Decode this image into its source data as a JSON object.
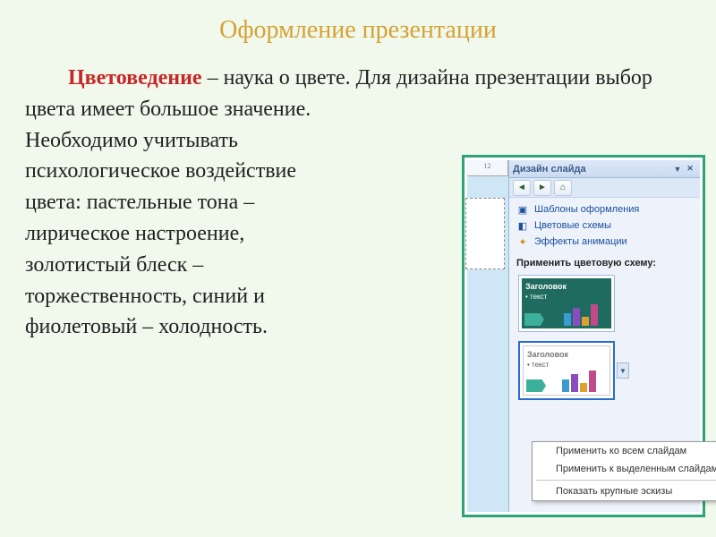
{
  "slide": {
    "title": "Оформление презентации",
    "term": "Цветоведение",
    "para1_rest": " – наука о цвете. Для дизайна презентации выбор цвета имеет большое значение.",
    "para2_lines": [
      "Необходимо учитывать",
      "психологическое воздействие",
      "цвета: пастельные тона –",
      "лирическое настроение,",
      "золотистый блеск –",
      "торжественность, синий и",
      "фиолетовый – холодность."
    ]
  },
  "pane": {
    "title": "Дизайн слайда",
    "ruler_mark": "12",
    "nav": {
      "back": "◄",
      "fwd": "►",
      "home": "⌂"
    },
    "links": {
      "templates": "Шаблоны оформления",
      "schemes": "Цветовые схемы",
      "animation": "Эффекты анимации"
    },
    "apply_label": "Применить цветовую схему:",
    "thumb": {
      "title": "Заголовок",
      "bullet": "• текст"
    },
    "menu": {
      "apply_all": "Применить ко всем слайдам",
      "apply_selected": "Применить к выделенным слайдам",
      "large_preview": "Показать крупные эскизы"
    },
    "glyphs": {
      "close": "✕",
      "dropdown": "▼"
    }
  }
}
